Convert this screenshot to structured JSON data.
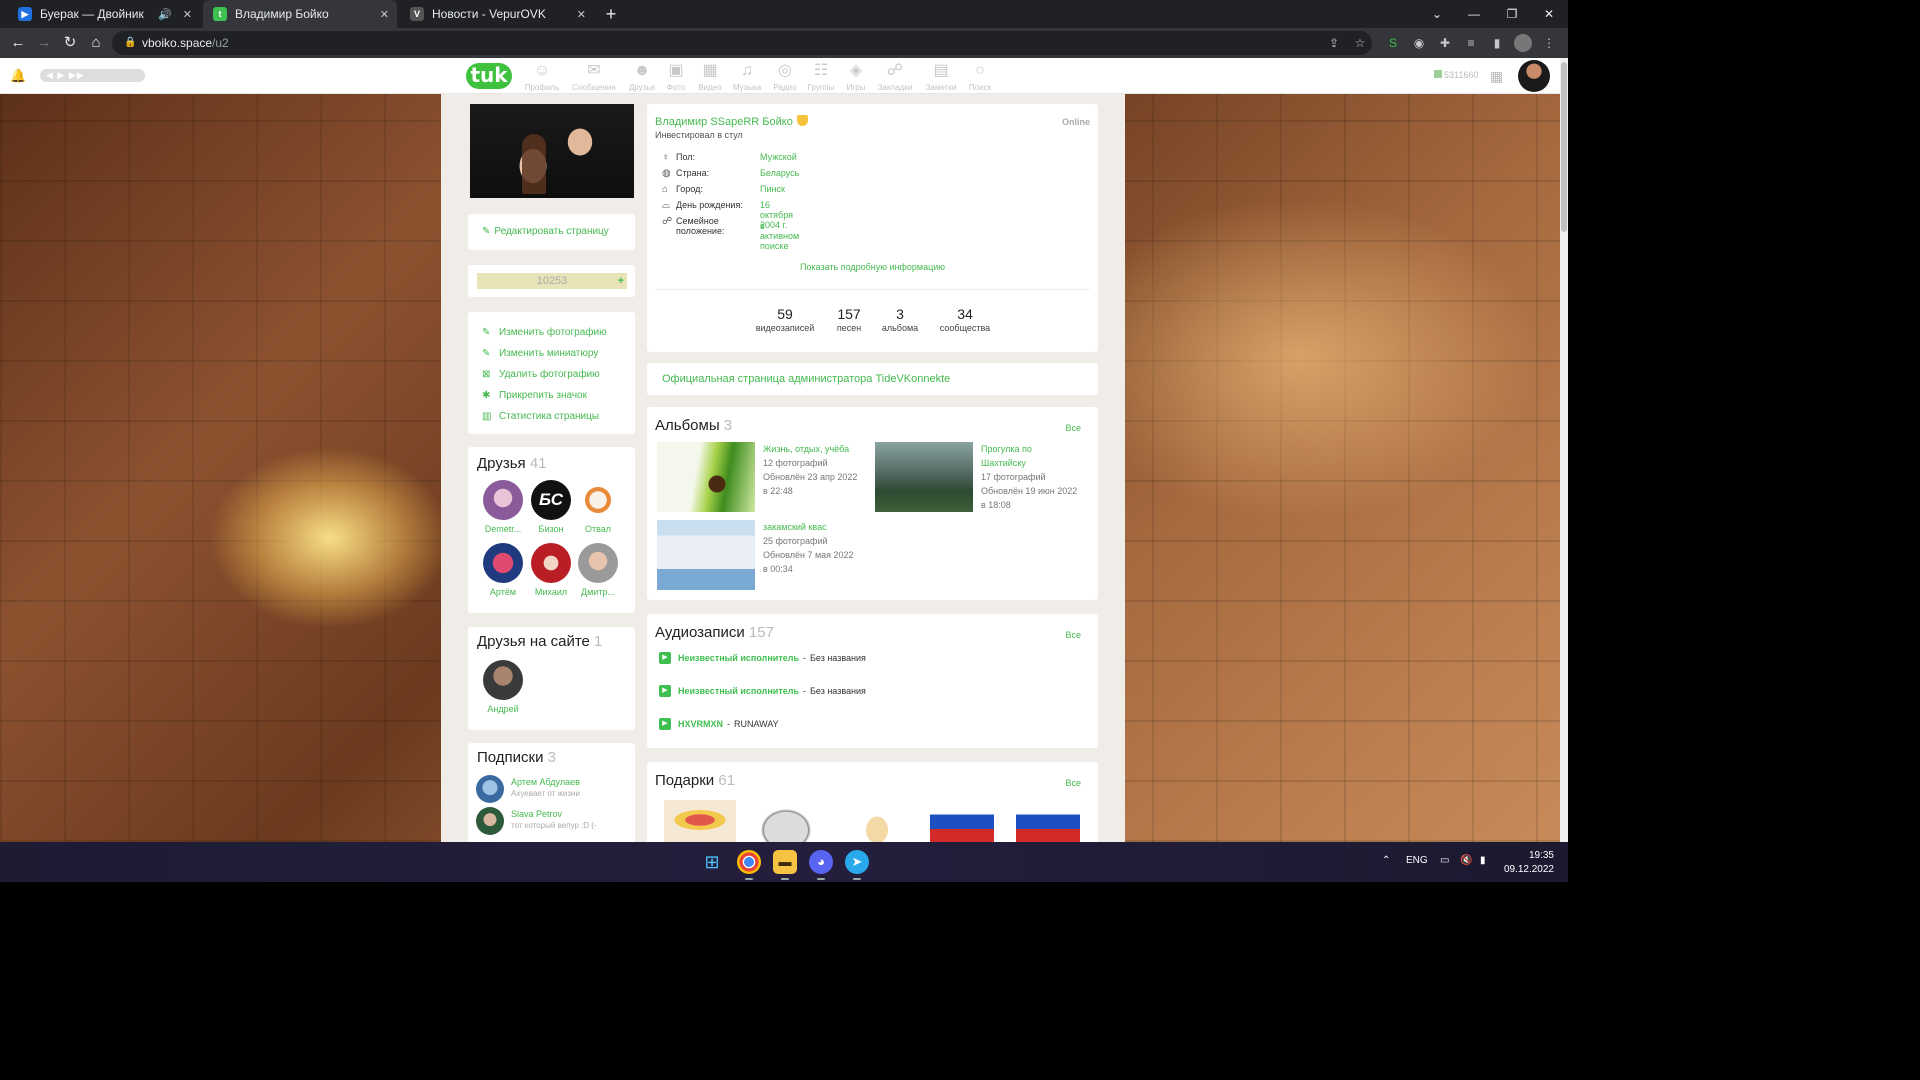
{
  "browser": {
    "tabs": [
      {
        "title": "Буерак — Двойник",
        "icon": "youtube-icon",
        "audio": true
      },
      {
        "title": "Владимир Бойко",
        "icon": "site-icon",
        "active": true
      },
      {
        "title": "Новости - VepurOVK",
        "icon": "vepur-icon"
      }
    ],
    "url_host": "vboiko.space",
    "url_path": "/u2"
  },
  "topnav": {
    "items": [
      "Профиль",
      "Сообщения",
      "Друзья",
      "Фото",
      "Видео",
      "Музыка",
      "Радио",
      "Группы",
      "Игры",
      "Закладки",
      "Заметки",
      "Поиск"
    ],
    "logo": "tuk",
    "balance": "5311660"
  },
  "sidebar": {
    "edit_label": "Редактировать страницу",
    "rating": "10253",
    "actions": [
      "Изменить фотографию",
      "Изменить миниатюру",
      "Удалить фотографию",
      "Прикрепить значок",
      "Статистика страницы"
    ],
    "friends_title": "Друзья",
    "friends_count": "41",
    "friends": [
      "Demetr...",
      "Бизон",
      "Отвал",
      "Артём",
      "Михаил",
      "Дмитр..."
    ],
    "friend_avatar_badge": "БС",
    "onsite_title": "Друзья на сайте",
    "onsite_count": "1",
    "onsite": [
      "Андрей"
    ],
    "subs_title": "Подписки",
    "subs_count": "3",
    "subs": [
      {
        "name": "Артем Абдулаев",
        "desc": "Ахуевает от жизни"
      },
      {
        "name": "Slava Petrov",
        "desc": "тот который вепур :D (-"
      }
    ]
  },
  "profile": {
    "name": "Владимир SSapeRR Бойко",
    "status": "Инвестировал в стул",
    "online": "Online",
    "fields": [
      {
        "label": "Пол:",
        "value": "Мужской"
      },
      {
        "label": "Страна:",
        "value": "Беларусь"
      },
      {
        "label": "Город:",
        "value": "Пинск"
      },
      {
        "label": "День рождения:",
        "value": "16 октября 2004 г."
      },
      {
        "label": "Семейное положение:",
        "value": "в активном поиске"
      }
    ],
    "more": "Показать подробную информацию",
    "stats": [
      {
        "n": "59",
        "l": "видеозаписей"
      },
      {
        "n": "157",
        "l": "песен"
      },
      {
        "n": "3",
        "l": "альбома"
      },
      {
        "n": "34",
        "l": "сообщества"
      }
    ]
  },
  "official": "Официальная страница администратора TideVKonnekte",
  "albums": {
    "title": "Альбомы",
    "count": "3",
    "all": "Все",
    "items": [
      {
        "name": "Жизнь, отдых, учёба",
        "photos": "12 фотографий",
        "updated": "Обновлён 23 апр 2022",
        "time": "в 22:48"
      },
      {
        "name": "Прогулка по Шахтийску",
        "photos": "17 фотографий",
        "updated": "Обновлён 19 июн 2022",
        "time": "в 18:08"
      },
      {
        "name": "закамский квас",
        "photos": "25 фотографий",
        "updated": "Обновлён 7 мая 2022",
        "time": "в 00:34"
      }
    ]
  },
  "audio": {
    "title": "Аудиозаписи",
    "count": "157",
    "all": "Все",
    "tracks": [
      {
        "artist": "Неизвестный исполнитель",
        "title": "Без названия"
      },
      {
        "artist": "Неизвестный исполнитель",
        "title": "Без названия"
      },
      {
        "artist": "HXVRMXN",
        "title": "RUNAWAY"
      }
    ]
  },
  "gifts": {
    "title": "Подарки",
    "count": "61",
    "all": "Все"
  },
  "taskbar": {
    "lang": "ENG",
    "time": "19:35",
    "date": "09.12.2022"
  }
}
